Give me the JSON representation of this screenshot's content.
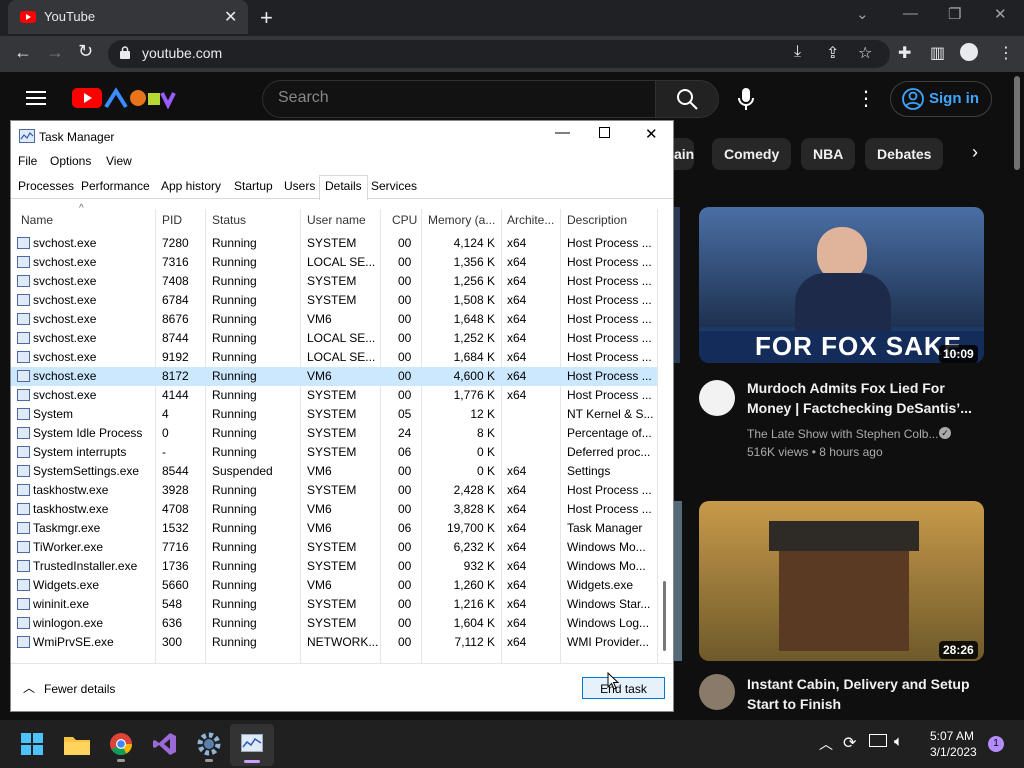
{
  "browser": {
    "tab_title": "YouTube",
    "tab_close": "✕",
    "new_tab": "+",
    "url": "youtube.com"
  },
  "youtube": {
    "search_placeholder": "Search",
    "signin_label": "Sign in",
    "chips": [
      "ain",
      "Comedy",
      "NBA",
      "Debates"
    ],
    "videos": [
      {
        "thumb_text": "FOR FOX SAKE",
        "duration": "10:09",
        "title": "Murdoch Admits Fox Lied For Money | Factchecking DeSantis’...",
        "channel": "The Late Show with Stephen Colb...",
        "meta": "516K views • 8 hours ago"
      },
      {
        "duration": "28:26",
        "title": "Instant Cabin, Delivery and Setup Start to Finish"
      }
    ]
  },
  "task_manager": {
    "title": "Task Manager",
    "menu": [
      "File",
      "Options",
      "View"
    ],
    "tabs": [
      "Processes",
      "Performance",
      "App history",
      "Startup",
      "Users",
      "Details",
      "Services"
    ],
    "active_tab": "Details",
    "columns": [
      "Name",
      "PID",
      "Status",
      "User name",
      "CPU",
      "Memory (a...",
      "Archite...",
      "Description"
    ],
    "rows": [
      [
        "svchost.exe",
        "7280",
        "Running",
        "SYSTEM",
        "00",
        "4,124 K",
        "x64",
        "Host Process ..."
      ],
      [
        "svchost.exe",
        "7316",
        "Running",
        "LOCAL SE...",
        "00",
        "1,356 K",
        "x64",
        "Host Process ..."
      ],
      [
        "svchost.exe",
        "7408",
        "Running",
        "SYSTEM",
        "00",
        "1,256 K",
        "x64",
        "Host Process ..."
      ],
      [
        "svchost.exe",
        "6784",
        "Running",
        "SYSTEM",
        "00",
        "1,508 K",
        "x64",
        "Host Process ..."
      ],
      [
        "svchost.exe",
        "8676",
        "Running",
        "VM6",
        "00",
        "1,648 K",
        "x64",
        "Host Process ..."
      ],
      [
        "svchost.exe",
        "8744",
        "Running",
        "LOCAL SE...",
        "00",
        "1,252 K",
        "x64",
        "Host Process ..."
      ],
      [
        "svchost.exe",
        "9192",
        "Running",
        "LOCAL SE...",
        "00",
        "1,684 K",
        "x64",
        "Host Process ..."
      ],
      [
        "svchost.exe",
        "8172",
        "Running",
        "VM6",
        "00",
        "4,600 K",
        "x64",
        "Host Process ..."
      ],
      [
        "svchost.exe",
        "4144",
        "Running",
        "SYSTEM",
        "00",
        "1,776 K",
        "x64",
        "Host Process ..."
      ],
      [
        "System",
        "4",
        "Running",
        "SYSTEM",
        "05",
        "12 K",
        "",
        "NT Kernel & S..."
      ],
      [
        "System Idle Process",
        "0",
        "Running",
        "SYSTEM",
        "24",
        "8 K",
        "",
        "Percentage of..."
      ],
      [
        "System interrupts",
        "-",
        "Running",
        "SYSTEM",
        "06",
        "0 K",
        "",
        "Deferred proc..."
      ],
      [
        "SystemSettings.exe",
        "8544",
        "Suspended",
        "VM6",
        "00",
        "0 K",
        "x64",
        "Settings"
      ],
      [
        "taskhostw.exe",
        "3928",
        "Running",
        "SYSTEM",
        "00",
        "2,428 K",
        "x64",
        "Host Process ..."
      ],
      [
        "taskhostw.exe",
        "4708",
        "Running",
        "VM6",
        "00",
        "3,828 K",
        "x64",
        "Host Process ..."
      ],
      [
        "Taskmgr.exe",
        "1532",
        "Running",
        "VM6",
        "06",
        "19,700 K",
        "x64",
        "Task Manager"
      ],
      [
        "TiWorker.exe",
        "7716",
        "Running",
        "SYSTEM",
        "00",
        "6,232 K",
        "x64",
        "Windows Mo..."
      ],
      [
        "TrustedInstaller.exe",
        "1736",
        "Running",
        "SYSTEM",
        "00",
        "932 K",
        "x64",
        "Windows Mo..."
      ],
      [
        "Widgets.exe",
        "5660",
        "Running",
        "VM6",
        "00",
        "1,260 K",
        "x64",
        "Widgets.exe"
      ],
      [
        "wininit.exe",
        "548",
        "Running",
        "SYSTEM",
        "00",
        "1,216 K",
        "x64",
        "Windows Star..."
      ],
      [
        "winlogon.exe",
        "636",
        "Running",
        "SYSTEM",
        "00",
        "1,604 K",
        "x64",
        "Windows Log..."
      ],
      [
        "WmiPrvSE.exe",
        "300",
        "Running",
        "NETWORK...",
        "00",
        "7,112 K",
        "x64",
        "WMI Provider..."
      ]
    ],
    "selected_row": 7,
    "fewer_details": "Fewer details",
    "end_task": "End task"
  },
  "taskbar": {
    "time": "5:07 AM",
    "date": "3/1/2023",
    "notifications": "1"
  },
  "colors": {
    "youtube_red": "#ff0000",
    "signin_blue": "#3ea6ff",
    "selection": "#cce8ff"
  }
}
